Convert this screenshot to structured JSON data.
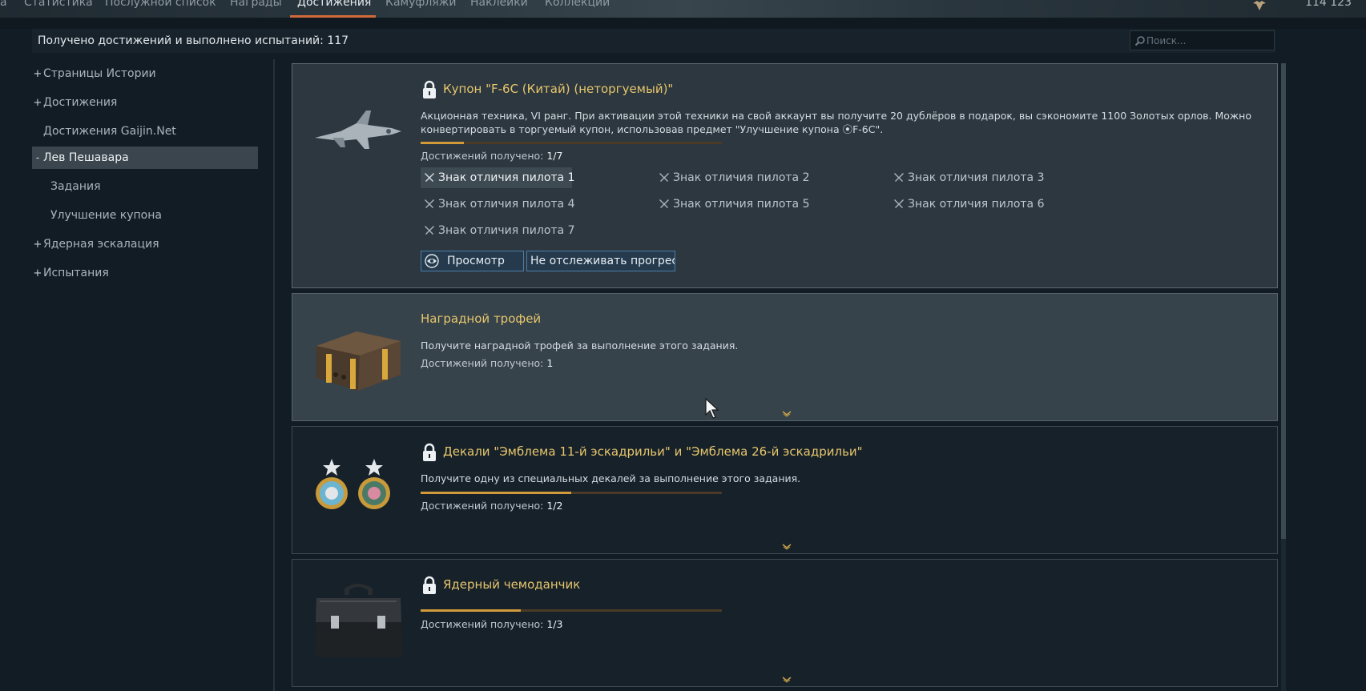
{
  "tabs": [
    {
      "label": "а"
    },
    {
      "label": "Статистика"
    },
    {
      "label": "Послужной список"
    },
    {
      "label": "Награды"
    },
    {
      "label": "Достижения",
      "active": true
    },
    {
      "label": "Камуфляжи"
    },
    {
      "label": "Наклейки"
    },
    {
      "label": "Коллекции"
    }
  ],
  "balance": "114 123",
  "summary": "Получено достижений и выполнено испытаний: 117",
  "search": {
    "placeholder": "Поиск...",
    "value": ""
  },
  "sidebar": {
    "items": [
      {
        "sign": "+",
        "label": "Страницы Истории"
      },
      {
        "sign": "+",
        "label": "Достижения"
      },
      {
        "sign": "",
        "label": "Достижения Gaijin.Net"
      },
      {
        "sign": "-",
        "label": "Лев Пешавара",
        "selected": true
      },
      {
        "sign": "",
        "label": "Задания"
      },
      {
        "sign": "",
        "label": "Улучшение купона"
      },
      {
        "sign": "+",
        "label": "Ядерная эскалация"
      },
      {
        "sign": "+",
        "label": "Испытания"
      }
    ]
  },
  "cards": [
    {
      "title": "Купон \"F-6C (Китай) (неторгуемый)\"",
      "locked": true,
      "description_line1": "Акционная техника, VI ранг. При активации этой техники на свой аккаунт вы получите 20 дублёров в подарок, вы сэкономите 1100 Золотых орлов. Можно",
      "description_line2": "конвертировать в торгуемый купон, использовав предмет \"Улучшение купона ⦿F-6C\".",
      "progress": 0.1429,
      "count_label": "Достижений получено: ",
      "count_value": "1/7",
      "rewards": [
        "Знак отличия пилота 1",
        "Знак отличия пилота 2",
        "Знак отличия пилота 3",
        "Знак отличия пилота 4",
        "Знак отличия пилота 5",
        "Знак отличия пилота 6",
        "Знак отличия пилота 7"
      ],
      "view_button": "Просмотр",
      "untrack_button": "Не отслеживать прогресс"
    },
    {
      "title": "Наградной трофей",
      "locked": false,
      "description": "Получите наградной трофей за выполнение этого задания.",
      "count_label": "Достижений получено: ",
      "count_value": "1"
    },
    {
      "title": "Декали \"Эмблема 11-й эскадрильи\" и \"Эмблема 26-й эскадрильи\"",
      "locked": true,
      "description": "Получите одну из специальных декалей за выполнение этого задания.",
      "progress": 0.5,
      "count_label": "Достижений получено: ",
      "count_value": "1/2"
    },
    {
      "title": "Ядерный чемоданчик",
      "locked": true,
      "progress": 0.3333,
      "count_label": "Достижений получено: ",
      "count_value": "1/3"
    }
  ],
  "colors": {
    "accent_gold": "#e7c66c",
    "progress_fill": "#d39a3a",
    "active_tab_underline": "#d06a3a",
    "button_border": "#4d7fa8"
  },
  "icons": [
    "eagle-icon",
    "search-icon",
    "lock-icon",
    "pilot-badge-icon",
    "eye-icon",
    "chevron-down-icon",
    "mouse-cursor-icon"
  ]
}
